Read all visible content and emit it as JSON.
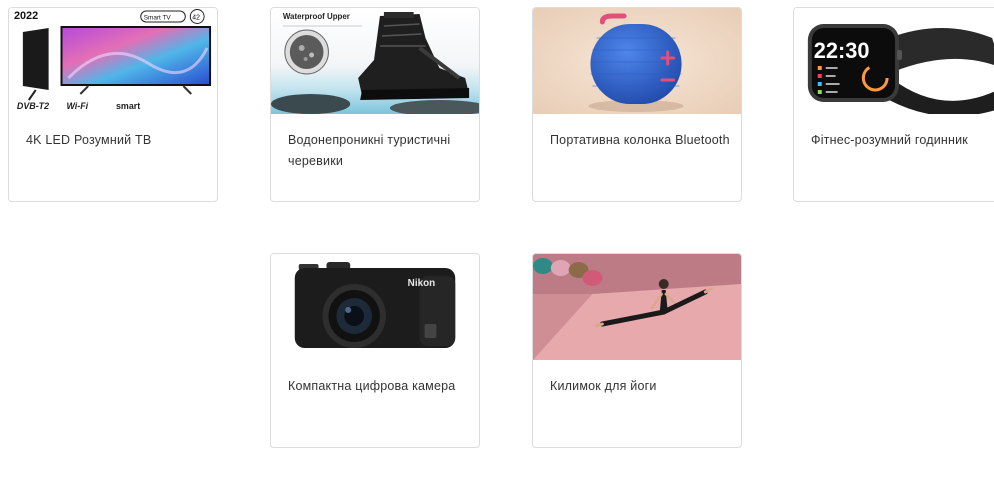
{
  "products": [
    {
      "title": "4K LED Розумний ТВ",
      "image_text": {
        "year": "2022",
        "badge": "Smart TV",
        "size": "42",
        "logos": [
          "DVB-T2",
          "Wi-Fi",
          "smart"
        ]
      }
    },
    {
      "title": "Водонепроникні туристичні черевики",
      "image_text": {
        "headline": "Waterproof Upper"
      }
    },
    {
      "title": "Портативна колонка Bluetooth",
      "image_text": {}
    },
    {
      "title": "Фітнес-розумний годинник",
      "image_text": {
        "time": "22:30"
      }
    },
    {
      "title": "Компактна цифрова камера",
      "image_text": {
        "brand": "Nikon"
      }
    },
    {
      "title": "Килимок для йоги",
      "image_text": {}
    }
  ],
  "colors": {
    "card_border": "#dcdcdc",
    "title_text": "#333333",
    "speaker_blue": "#2c5fc8",
    "mat_pink": "#e8a9ad"
  }
}
